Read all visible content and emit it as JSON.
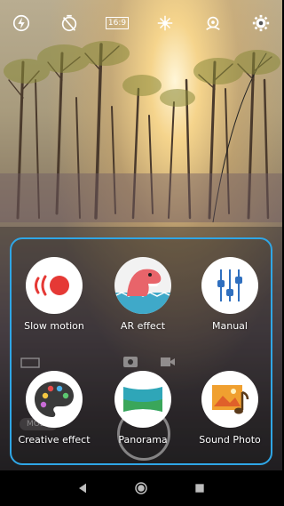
{
  "top_bar": {
    "icons": [
      "flash-auto-icon",
      "timer-off-icon",
      "aspect-ratio-icon",
      "exposure-icon",
      "camera-switch-icon",
      "settings-icon"
    ],
    "aspect_ratio_label": "16:9"
  },
  "mode_menu": {
    "accent_color": "#2fa6e6",
    "modes": [
      {
        "label": "Slow motion",
        "icon": "slow-motion-icon"
      },
      {
        "label": "AR effect",
        "icon": "ar-effect-dinosaur-icon"
      },
      {
        "label": "Manual",
        "icon": "manual-sliders-icon"
      },
      {
        "label": "Creative effect",
        "icon": "creative-effect-palette-icon"
      },
      {
        "label": "Panorama",
        "icon": "panorama-icon"
      },
      {
        "label": "Sound Photo",
        "icon": "sound-photo-icon"
      }
    ]
  },
  "background_ui": {
    "mode_label": "MODE"
  },
  "nav_bar": {
    "icons": [
      "back-icon",
      "home-icon",
      "recents-icon"
    ]
  }
}
